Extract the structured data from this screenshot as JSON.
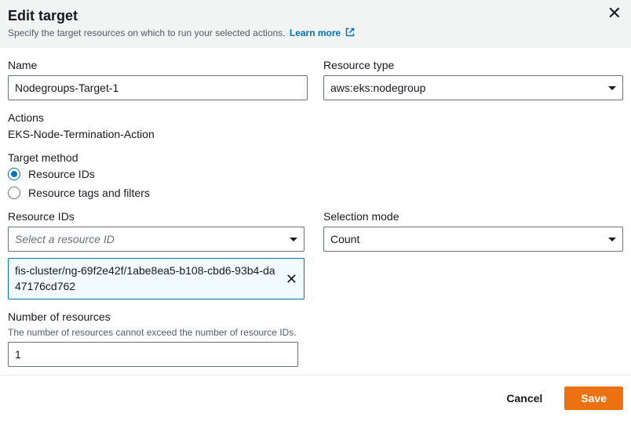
{
  "header": {
    "title": "Edit target",
    "subtitle": "Specify the target resources on which to run your selected actions.",
    "learn_more": "Learn more"
  },
  "name": {
    "label": "Name",
    "value": "Nodegroups-Target-1"
  },
  "resource_type": {
    "label": "Resource type",
    "value": "aws:eks:nodegroup"
  },
  "actions": {
    "label": "Actions",
    "value": "EKS-Node-Termination-Action"
  },
  "target_method": {
    "label": "Target method",
    "options": {
      "ids": "Resource IDs",
      "tags": "Resource tags and filters"
    },
    "selected": "ids"
  },
  "resource_ids": {
    "label": "Resource IDs",
    "placeholder": "Select a resource ID",
    "chip": "fis-cluster/ng-69f2e42f/1abe8ea5-b108-cbd6-93b4-da47176cd762"
  },
  "selection_mode": {
    "label": "Selection mode",
    "value": "Count"
  },
  "num_resources": {
    "label": "Number of resources",
    "hint": "The number of resources cannot exceed the number of resource IDs.",
    "value": "1"
  },
  "footer": {
    "cancel": "Cancel",
    "save": "Save"
  }
}
